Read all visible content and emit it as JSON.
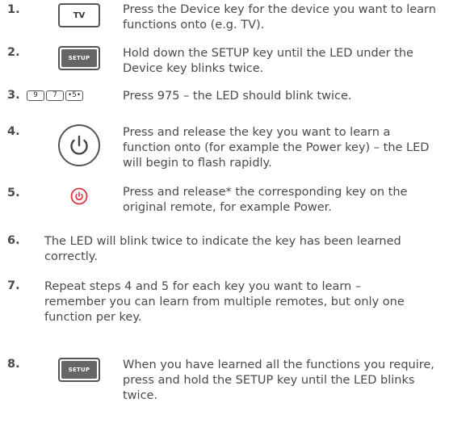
{
  "steps": [
    {
      "num": "1.",
      "icon": "tv-key-icon",
      "key_label": "TV",
      "text": "Press the Device key for the device you want to learn functions onto (e.g. TV)."
    },
    {
      "num": "2.",
      "icon": "setup-key-icon",
      "key_label": "SETUP",
      "text": "Hold down the SETUP key until the LED under the Device key blinks twice."
    },
    {
      "num": "3.",
      "icon": "number-keys-icon",
      "keys": [
        "9",
        "7",
        "•5•"
      ],
      "text": "Press 975 – the LED should blink twice."
    },
    {
      "num": "4.",
      "icon": "power-key-icon",
      "text": "Press and release the key you want to learn a function onto (for example the Power key) – the LED will begin to flash rapidly."
    },
    {
      "num": "5.",
      "icon": "red-power-icon",
      "text": "Press and release* the corresponding key on the original remote, for example Power."
    },
    {
      "num": "6.",
      "text": "The LED will blink twice to indicate the key has been learned correctly."
    },
    {
      "num": "7.",
      "text": "Repeat steps 4 and 5 for each key you want to learn – remember you can learn from multiple remotes, but only one function per key."
    },
    {
      "num": "8.",
      "icon": "setup-key-icon",
      "key_label": "SETUP",
      "text": "When you have learned all the functions you require, press and hold the SETUP key until the LED blinks twice."
    }
  ],
  "colors": {
    "text": "#4a4a4a",
    "red_power": "#e0313f"
  }
}
